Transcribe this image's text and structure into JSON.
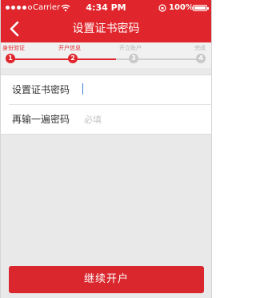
{
  "status_bar": {
    "carrier": "Carrier",
    "time": "4:34 PM",
    "battery": "100%"
  },
  "nav": {
    "title": "设置证书密码",
    "back_icon": "chevron-left-icon"
  },
  "steps": [
    {
      "label": "身份验证",
      "number": "1",
      "state": "active"
    },
    {
      "label": "开户信息",
      "number": "2",
      "state": "active"
    },
    {
      "label": "开立账户",
      "number": "3",
      "state": "inactive"
    },
    {
      "label": "完成",
      "number": "4",
      "state": "inactive"
    }
  ],
  "form": {
    "password_label": "设置证书密码",
    "password_value": "",
    "confirm_label": "再输一遍密码",
    "confirm_placeholder": "必填"
  },
  "actions": {
    "continue_label": "继续开户"
  },
  "colors": {
    "accent": "#e0262c",
    "background": "#e9e9e9",
    "inactive": "#c9c9c9"
  }
}
